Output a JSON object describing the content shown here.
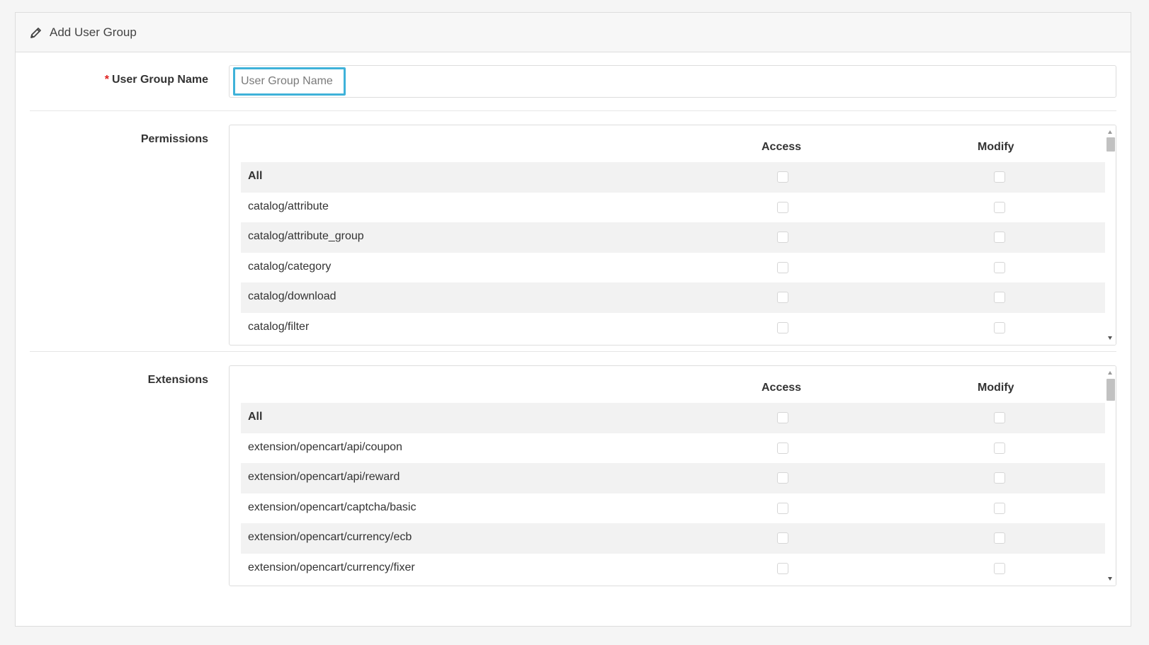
{
  "header": {
    "title": "Add User Group",
    "icon": "pencil-icon"
  },
  "user_group_name": {
    "label": "User Group Name",
    "required_marker": "*",
    "placeholder": "User Group Name",
    "value": ""
  },
  "permissions": {
    "label": "Permissions",
    "col_access": "Access",
    "col_modify": "Modify",
    "rows": [
      "All",
      "catalog/attribute",
      "catalog/attribute_group",
      "catalog/category",
      "catalog/download",
      "catalog/filter"
    ]
  },
  "extensions": {
    "label": "Extensions",
    "col_access": "Access",
    "col_modify": "Modify",
    "rows": [
      "All",
      "extension/opencart/api/coupon",
      "extension/opencart/api/reward",
      "extension/opencart/captcha/basic",
      "extension/opencart/currency/ecb",
      "extension/opencart/currency/fixer"
    ]
  },
  "colors": {
    "focus_border": "#3fb2d9",
    "required": "#e0201e",
    "row_alt": "#f2f2f2"
  }
}
